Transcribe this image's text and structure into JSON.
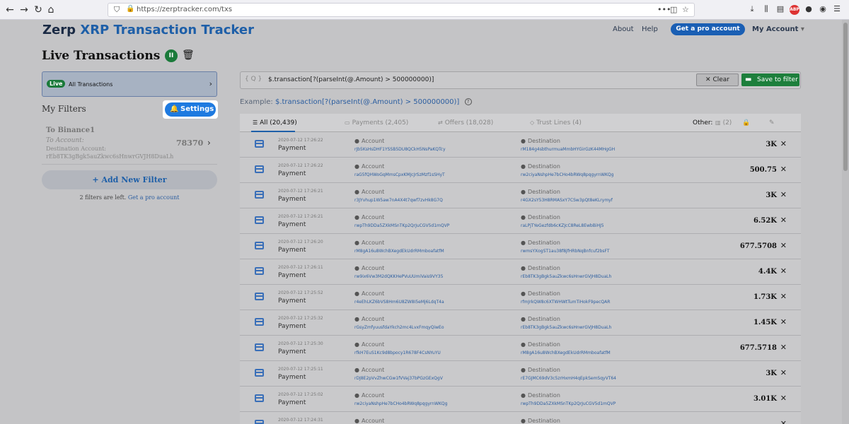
{
  "browser": {
    "back": "←",
    "forward": "→",
    "reload": "↻",
    "home": "⌂",
    "url": "https://zerptracker.com/txs"
  },
  "header": {
    "brand_bold": "Zerp",
    "brand_rest": "XRP Transaction Tracker",
    "about": "About",
    "help": "Help",
    "pro_button": "Get a pro account",
    "my_account": "My Account",
    "caret": "▾"
  },
  "page": {
    "title": "Live Transactions"
  },
  "live_filter": {
    "badge": "Live",
    "label": "All Transactions"
  },
  "filters": {
    "heading": "My Filters",
    "settings_label": "Settings",
    "items": [
      {
        "title": "To Binance1",
        "sub": "To Account:",
        "dest_label": "Destination Account:",
        "dest": "rEb8TK3gBgk5auZkwc6sHnwrGVJH8DuaLh",
        "count": "78370"
      }
    ],
    "add_label": "+ Add New Filter",
    "left_text": "2 filters are left.",
    "left_link": "Get a pro account"
  },
  "query": {
    "braces": "{ Q }",
    "value": "$.transaction[?(parseInt(@.Amount) > 500000000)]",
    "clear": "Clear",
    "save": "Save to filter",
    "example_label": "Example:",
    "example_code": "$.transaction[?(parseInt(@.Amount) > 500000000)]"
  },
  "tabs": {
    "all": "All (20,439)",
    "payments": "Payments (2,405)",
    "offers": "Offers (18,028)",
    "trust": "Trust Lines (4)",
    "other_label": "Other:",
    "other_count": "(2)"
  },
  "columns": {
    "account": "Account",
    "destination": "Destination"
  },
  "transactions": [
    {
      "date": "2020-07-12 17:26:22",
      "type": "Payment",
      "account": "rJb5KsHsDHF1YSSB5DU8QCkH5NsPaKQTcy",
      "destination": "rM184g4sbthurmuaMmbHYGirGzK44MHgGH",
      "amount": "3K"
    },
    {
      "date": "2020-07-12 17:26:22",
      "type": "Payment",
      "account": "raG5fQHWoGqMmsCpxKMJcJrSzMzf1sSHyT",
      "destination": "rw2ciyaNshpHe7bCHo4bRWq8pqgyrnWKQg",
      "amount": "500.75"
    },
    {
      "date": "2020-07-12 17:26:21",
      "type": "Payment",
      "account": "r3JYvhup1W5aw7nA4X4t7qwf7zvHk8G7Q",
      "destination": "r4GX2sY53H8RMASxY7CSw3pQt8eKLrymyf",
      "amount": "3K"
    },
    {
      "date": "2020-07-12 17:26:21",
      "type": "Payment",
      "account": "rwpTh9DDa5ZXkMSnTKp2QrJuCGV5d1mQVP",
      "destination": "raLPjTYeGezfdb6cKZJcC8ReL8EwbBiHJ5",
      "amount": "6.52K"
    },
    {
      "date": "2020-07-12 17:26:20",
      "type": "Payment",
      "account": "rM8gA16u8WchBXegdEkUdrRMmboafatfM",
      "destination": "rwmsYXogST1au38f8jfHRbNqBnfcuf2bsFT",
      "amount": "677.5708"
    },
    {
      "date": "2020-07-12 17:26:11",
      "type": "Payment",
      "account": "rw9ix6Vw3M2dQKKHePVuUUmiVais9VY35",
      "destination": "rEb8TK3gBgk5auZkwc6sHnwrGVJH8DuaLh",
      "amount": "4.4K"
    },
    {
      "date": "2020-07-12 17:25:52",
      "type": "Payment",
      "account": "r4eEhLKZ6bVS8Hm6U8ZW8I5eMj6LdqT4a",
      "destination": "rfmJrkQW8c6XTWHWtTumTiHokF9pecQAR",
      "amount": "1.73K"
    },
    {
      "date": "2020-07-12 17:25:32",
      "type": "Payment",
      "account": "rGsyZmfyuusfdaYkch2mc4LvxFmqyQiwEo",
      "destination": "rEb8TK3gBgk5auZkwc6sHnwrGVJH8DuaLh",
      "amount": "1.45K"
    },
    {
      "date": "2020-07-12 17:25:30",
      "type": "Payment",
      "account": "rfkH7EuS1Kc9d8bpocy1R678F4CsNYuYU",
      "destination": "rM8gA16u8WchBXegdEkUdrRMmboafatfM",
      "amount": "677.5718"
    },
    {
      "date": "2020-07-12 17:25:11",
      "type": "Payment",
      "account": "rDJ8E2pVvZhwCGw1fVVaj37bPGzGExQgV",
      "destination": "rE7GJMC69dV3c5zrHxmH4qEpkSemSqyVT64",
      "amount": "3K"
    },
    {
      "date": "2020-07-12 17:25:02",
      "type": "Payment",
      "account": "rw2ciyaNshpHe7bCHo4bRWq8pqgyrnWKQg",
      "destination": "rwpTh9DDa5ZXkMSnTKp2QrJuCGV5d1mQVP",
      "amount": "3.01K"
    },
    {
      "date": "2020-07-12 17:24:31",
      "type": "",
      "account": "",
      "destination": "",
      "amount": ""
    }
  ]
}
